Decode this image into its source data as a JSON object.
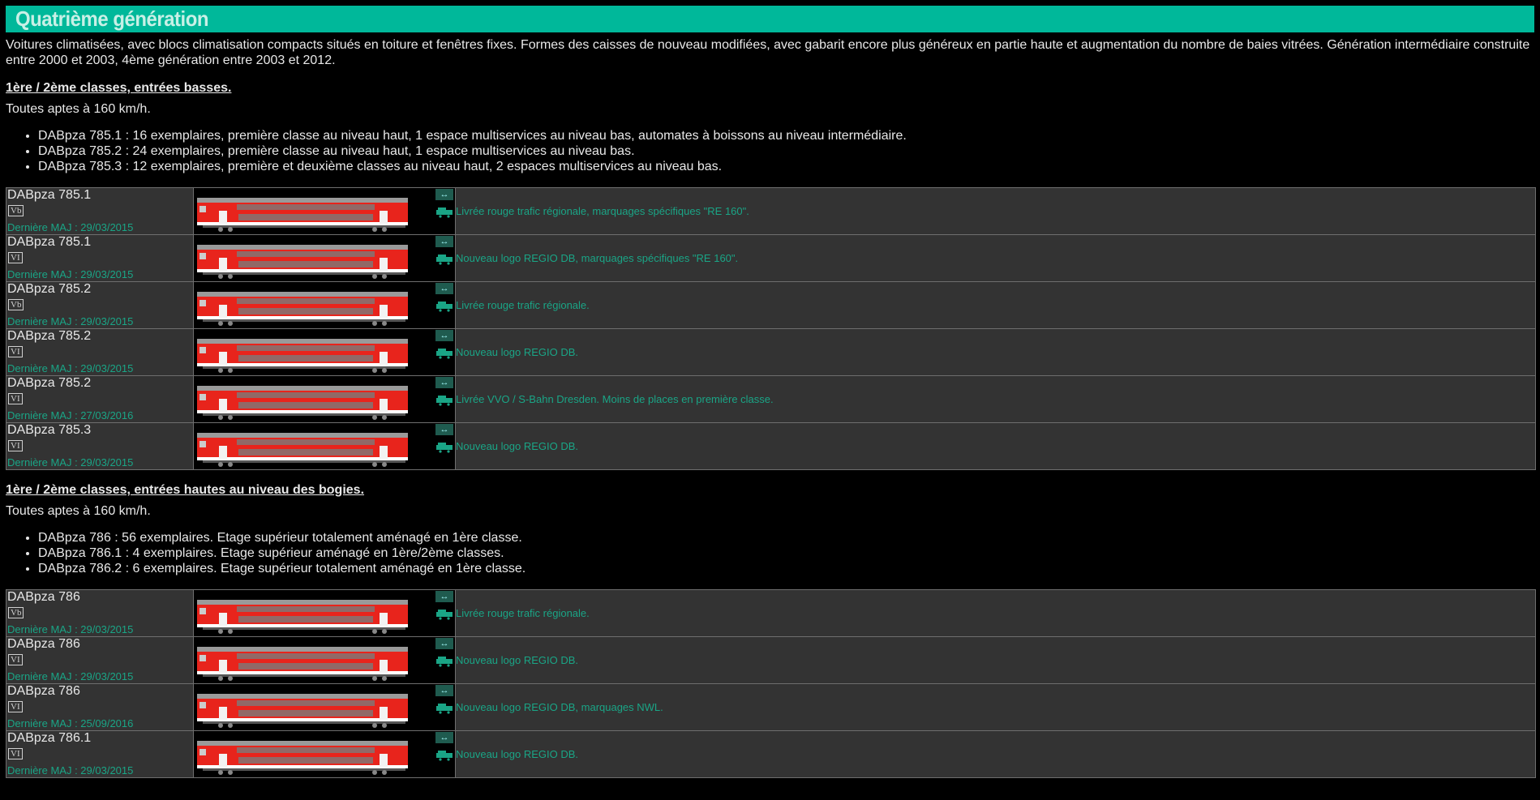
{
  "title": "Quatrième génération",
  "intro": "Voitures climatisées, avec blocs climatisation compacts situés en toiture et fenêtres fixes. Formes des caisses de nouveau modifiées, avec gabarit encore plus généreux en partie haute et augmentation du nombre de baies vitrées. Génération intermédiaire construite entre 2000 et 2003, 4ème génération entre 2003 et 2012.",
  "sections": [
    {
      "title": "1ère / 2ème classes, entrées basses.",
      "aptes": "Toutes aptes à 160 km/h.",
      "variants": [
        "DABpza 785.1 : 16 exemplaires, première classe au niveau haut, 1 espace multiservices au niveau bas, automates à boissons au niveau intermédiaire.",
        "DABpza 785.2 : 24 exemplaires, première classe au niveau haut, 1 espace multiservices au niveau bas.",
        "DABpza 785.3 : 12 exemplaires, première et deuxième classes au niveau haut, 2 espaces multiservices au niveau bas."
      ],
      "rows": [
        {
          "name": "DABpza 785.1",
          "epoch": "Vb",
          "maj": "Dernière MAJ : 29/03/2015",
          "desc": "Livrée rouge trafic régionale, marquages spécifiques \"RE 160\"."
        },
        {
          "name": "DABpza 785.1",
          "epoch": "VI",
          "maj": "Dernière MAJ : 29/03/2015",
          "desc": "Nouveau logo REGIO DB, marquages spécifiques \"RE 160\"."
        },
        {
          "name": "DABpza 785.2",
          "epoch": "Vb",
          "maj": "Dernière MAJ : 29/03/2015",
          "desc": "Livrée rouge trafic régionale."
        },
        {
          "name": "DABpza 785.2",
          "epoch": "VI",
          "maj": "Dernière MAJ : 29/03/2015",
          "desc": "Nouveau logo REGIO DB."
        },
        {
          "name": "DABpza 785.2",
          "epoch": "VI",
          "maj": "Dernière MAJ : 27/03/2016",
          "desc": "Livrée VVO / S-Bahn Dresden. Moins de places en première classe."
        },
        {
          "name": "DABpza 785.3",
          "epoch": "VI",
          "maj": "Dernière MAJ : 29/03/2015",
          "desc": "Nouveau logo REGIO DB."
        }
      ]
    },
    {
      "title": "1ère / 2ème classes, entrées hautes au niveau des bogies.",
      "aptes": "Toutes aptes à 160 km/h.",
      "variants": [
        "DABpza 786 : 56 exemplaires. Etage supérieur totalement aménagé en 1ère classe.",
        "DABpza 786.1 : 4 exemplaires. Etage supérieur aménagé en 1ère/2ème classes.",
        "DABpza 786.2 : 6 exemplaires. Etage supérieur totalement aménagé en 1ère classe."
      ],
      "rows": [
        {
          "name": "DABpza 786",
          "epoch": "Vb",
          "maj": "Dernière MAJ : 29/03/2015",
          "desc": "Livrée rouge trafic régionale."
        },
        {
          "name": "DABpza 786",
          "epoch": "VI",
          "maj": "Dernière MAJ : 29/03/2015",
          "desc": "Nouveau logo REGIO DB."
        },
        {
          "name": "DABpza 786",
          "epoch": "VI",
          "maj": "Dernière MAJ : 25/09/2016",
          "desc": "Nouveau logo REGIO DB, marquages NWL."
        },
        {
          "name": "DABpza 786.1",
          "epoch": "VI",
          "maj": "Dernière MAJ : 29/03/2015",
          "desc": "Nouveau logo REGIO DB."
        }
      ]
    }
  ],
  "colors": {
    "banner": "#00b89a",
    "accent": "#1aa586",
    "coach_red": "#e8241c",
    "row_bg": "#333333"
  },
  "icons": {
    "swap": "swap-direction-icon",
    "loco": "locomotive-icon"
  }
}
